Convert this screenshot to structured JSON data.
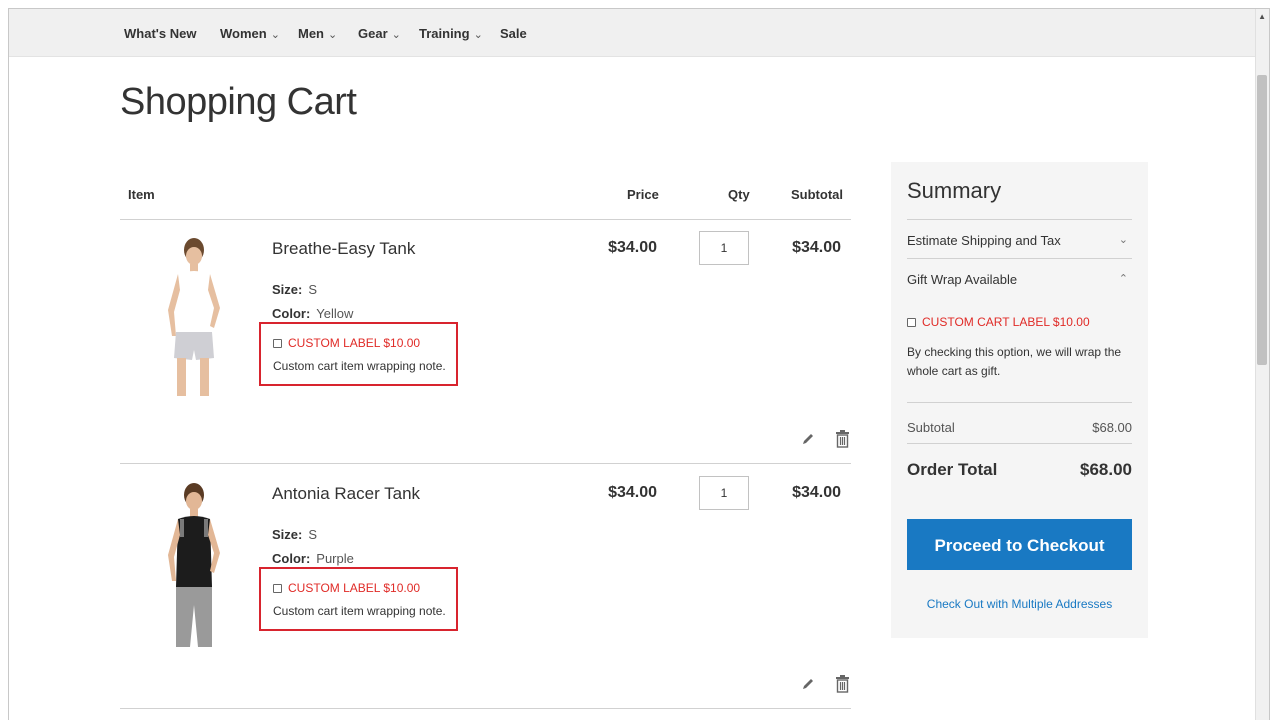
{
  "nav": {
    "items": [
      {
        "label": "What's New",
        "has_dropdown": false
      },
      {
        "label": "Women",
        "has_dropdown": true
      },
      {
        "label": "Men",
        "has_dropdown": true
      },
      {
        "label": "Gear",
        "has_dropdown": true
      },
      {
        "label": "Training",
        "has_dropdown": true
      },
      {
        "label": "Sale",
        "has_dropdown": false
      }
    ]
  },
  "page": {
    "title": "Shopping Cart"
  },
  "cart": {
    "columns": {
      "item": "Item",
      "price": "Price",
      "qty": "Qty",
      "subtotal": "Subtotal"
    },
    "items": [
      {
        "name": "Breathe-Easy Tank",
        "size_label": "Size:",
        "size": "S",
        "color_label": "Color:",
        "color": "Yellow",
        "price": "$34.00",
        "qty": "1",
        "subtotal": "$34.00",
        "gift_label": "CUSTOM LABEL $10.00",
        "gift_note": "Custom cart item wrapping note.",
        "image": {
          "top_color": "#ffffff",
          "bottom_color": "#cfcfd4"
        }
      },
      {
        "name": "Antonia Racer Tank",
        "size_label": "Size:",
        "size": "S",
        "color_label": "Color:",
        "color": "Purple",
        "price": "$34.00",
        "qty": "1",
        "subtotal": "$34.00",
        "gift_label": "CUSTOM LABEL $10.00",
        "gift_note": "Custom cart item wrapping note.",
        "image": {
          "top_color": "#1c1c1c",
          "bottom_color": "#9a9a9a"
        }
      }
    ],
    "icons": {
      "edit": "pencil-icon",
      "delete": "trash-icon"
    }
  },
  "summary": {
    "title": "Summary",
    "shipping_label": "Estimate Shipping and Tax",
    "gift_wrap_label": "Gift Wrap Available",
    "cart_gift_label": "CUSTOM CART LABEL $10.00",
    "cart_gift_desc": "By checking this option, we will wrap the whole cart as gift.",
    "subtotal_label": "Subtotal",
    "subtotal_value": "$68.00",
    "order_total_label": "Order Total",
    "order_total_value": "$68.00",
    "checkout_label": "Proceed to Checkout",
    "multi_address_label": "Check Out with Multiple Addresses"
  },
  "colors": {
    "accent": "#1979c3",
    "gift_label": "#e02b27",
    "highlight_border": "#d8242e",
    "nav_bg": "#f0f0f0",
    "summary_bg": "#f5f5f5"
  }
}
